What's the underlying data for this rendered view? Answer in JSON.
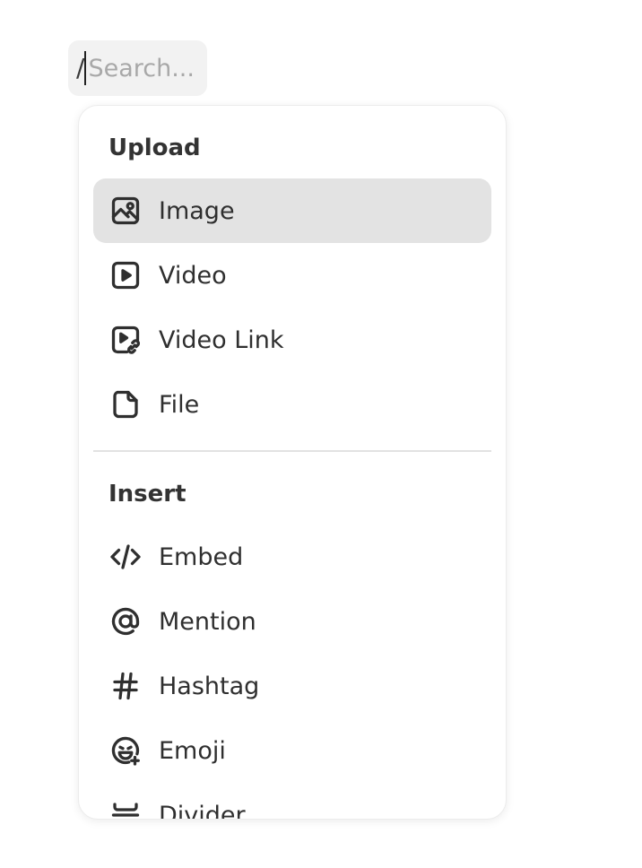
{
  "search": {
    "slash": "/",
    "placeholder": "Search..."
  },
  "menu": {
    "sections": [
      {
        "title": "Upload",
        "items": [
          {
            "label": "Image",
            "icon": "image-icon",
            "active": true
          },
          {
            "label": "Video",
            "icon": "video-icon"
          },
          {
            "label": "Video Link",
            "icon": "video-link-icon"
          },
          {
            "label": "File",
            "icon": "file-icon"
          }
        ]
      },
      {
        "title": "Insert",
        "items": [
          {
            "label": "Embed",
            "icon": "code-icon"
          },
          {
            "label": "Mention",
            "icon": "at-icon"
          },
          {
            "label": "Hashtag",
            "icon": "hashtag-icon"
          },
          {
            "label": "Emoji",
            "icon": "emoji-icon"
          },
          {
            "label": "Divider",
            "icon": "divider-icon"
          }
        ]
      }
    ]
  },
  "colors": {
    "active_background": "#e3e3e3",
    "search_background": "#f2f2f2",
    "placeholder": "#a8a8a8",
    "divider": "#e2e2e2"
  }
}
